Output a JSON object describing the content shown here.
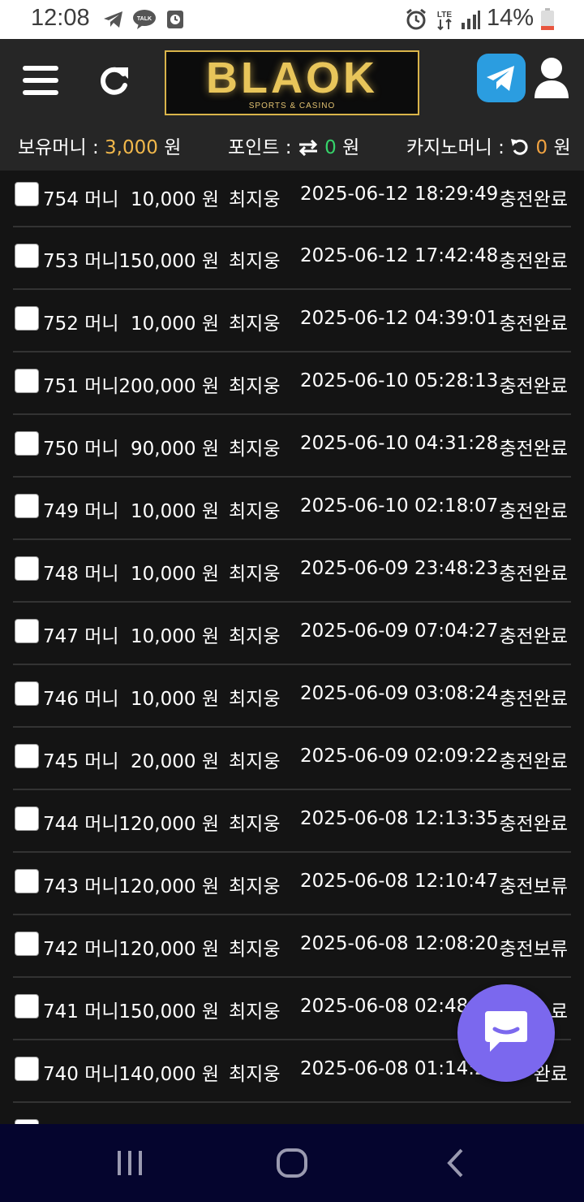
{
  "status_bar": {
    "time": "12:08",
    "talk_label": "TALK",
    "network": "LTE",
    "battery": "14%",
    "icons": [
      "telegram-icon",
      "kakaotalk-icon",
      "clock-app-icon",
      "alarm-icon",
      "lte-icon",
      "signal-icon",
      "battery-icon"
    ]
  },
  "header": {
    "logo_text": "BLAOK",
    "logo_subtitle": "SPORTS & CASINO",
    "icons": [
      "menu-icon",
      "refresh-icon",
      "telegram-icon",
      "user-icon"
    ]
  },
  "balances": {
    "money_label": "보유머니 :",
    "money_value": "3,000",
    "money_unit": "원",
    "point_label": "포인트 :",
    "point_value": "0",
    "point_unit": "원",
    "casino_label": "카지노머니 :",
    "casino_value": "0",
    "casino_unit": "원"
  },
  "columns": [
    "id",
    "type",
    "amount",
    "unit",
    "user",
    "datetime",
    "status"
  ],
  "rows": [
    {
      "id": "754",
      "type": "머니",
      "amount": "10,000",
      "unit": "원",
      "user": "최지웅",
      "datetime": "2025-06-12 18:29:49",
      "status": "충전완료"
    },
    {
      "id": "753",
      "type": "머니",
      "amount": "150,000",
      "unit": "원",
      "user": "최지웅",
      "datetime": "2025-06-12 17:42:48",
      "status": "충전완료"
    },
    {
      "id": "752",
      "type": "머니",
      "amount": "10,000",
      "unit": "원",
      "user": "최지웅",
      "datetime": "2025-06-12 04:39:01",
      "status": "충전완료"
    },
    {
      "id": "751",
      "type": "머니",
      "amount": "200,000",
      "unit": "원",
      "user": "최지웅",
      "datetime": "2025-06-10 05:28:13",
      "status": "충전완료"
    },
    {
      "id": "750",
      "type": "머니",
      "amount": "90,000",
      "unit": "원",
      "user": "최지웅",
      "datetime": "2025-06-10 04:31:28",
      "status": "충전완료"
    },
    {
      "id": "749",
      "type": "머니",
      "amount": "10,000",
      "unit": "원",
      "user": "최지웅",
      "datetime": "2025-06-10 02:18:07",
      "status": "충전완료"
    },
    {
      "id": "748",
      "type": "머니",
      "amount": "10,000",
      "unit": "원",
      "user": "최지웅",
      "datetime": "2025-06-09 23:48:23",
      "status": "충전완료"
    },
    {
      "id": "747",
      "type": "머니",
      "amount": "10,000",
      "unit": "원",
      "user": "최지웅",
      "datetime": "2025-06-09 07:04:27",
      "status": "충전완료"
    },
    {
      "id": "746",
      "type": "머니",
      "amount": "10,000",
      "unit": "원",
      "user": "최지웅",
      "datetime": "2025-06-09 03:08:24",
      "status": "충전완료"
    },
    {
      "id": "745",
      "type": "머니",
      "amount": "20,000",
      "unit": "원",
      "user": "최지웅",
      "datetime": "2025-06-09 02:09:22",
      "status": "충전완료"
    },
    {
      "id": "744",
      "type": "머니",
      "amount": "120,000",
      "unit": "원",
      "user": "최지웅",
      "datetime": "2025-06-08 12:13:35",
      "status": "충전완료"
    },
    {
      "id": "743",
      "type": "머니",
      "amount": "120,000",
      "unit": "원",
      "user": "최지웅",
      "datetime": "2025-06-08 12:10:47",
      "status": "충전보류"
    },
    {
      "id": "742",
      "type": "머니",
      "amount": "120,000",
      "unit": "원",
      "user": "최지웅",
      "datetime": "2025-06-08 12:08:20",
      "status": "충전보류"
    },
    {
      "id": "741",
      "type": "머니",
      "amount": "150,000",
      "unit": "원",
      "user": "최지웅",
      "datetime": "2025-06-08 02:48:",
      "status": "료"
    },
    {
      "id": "740",
      "type": "머니",
      "amount": "140,000",
      "unit": "원",
      "user": "최지웅",
      "datetime": "2025-06-08 01:14:2",
      "status": "완료"
    }
  ],
  "colors": {
    "money_value": "#f2b84b",
    "point_value": "#36d36a",
    "casino_value": "#f2a341",
    "chat_fab": "#7b68ee",
    "navbar": "#05052e"
  },
  "nav": {
    "icons": [
      "recent-apps-icon",
      "home-icon",
      "back-icon"
    ]
  }
}
